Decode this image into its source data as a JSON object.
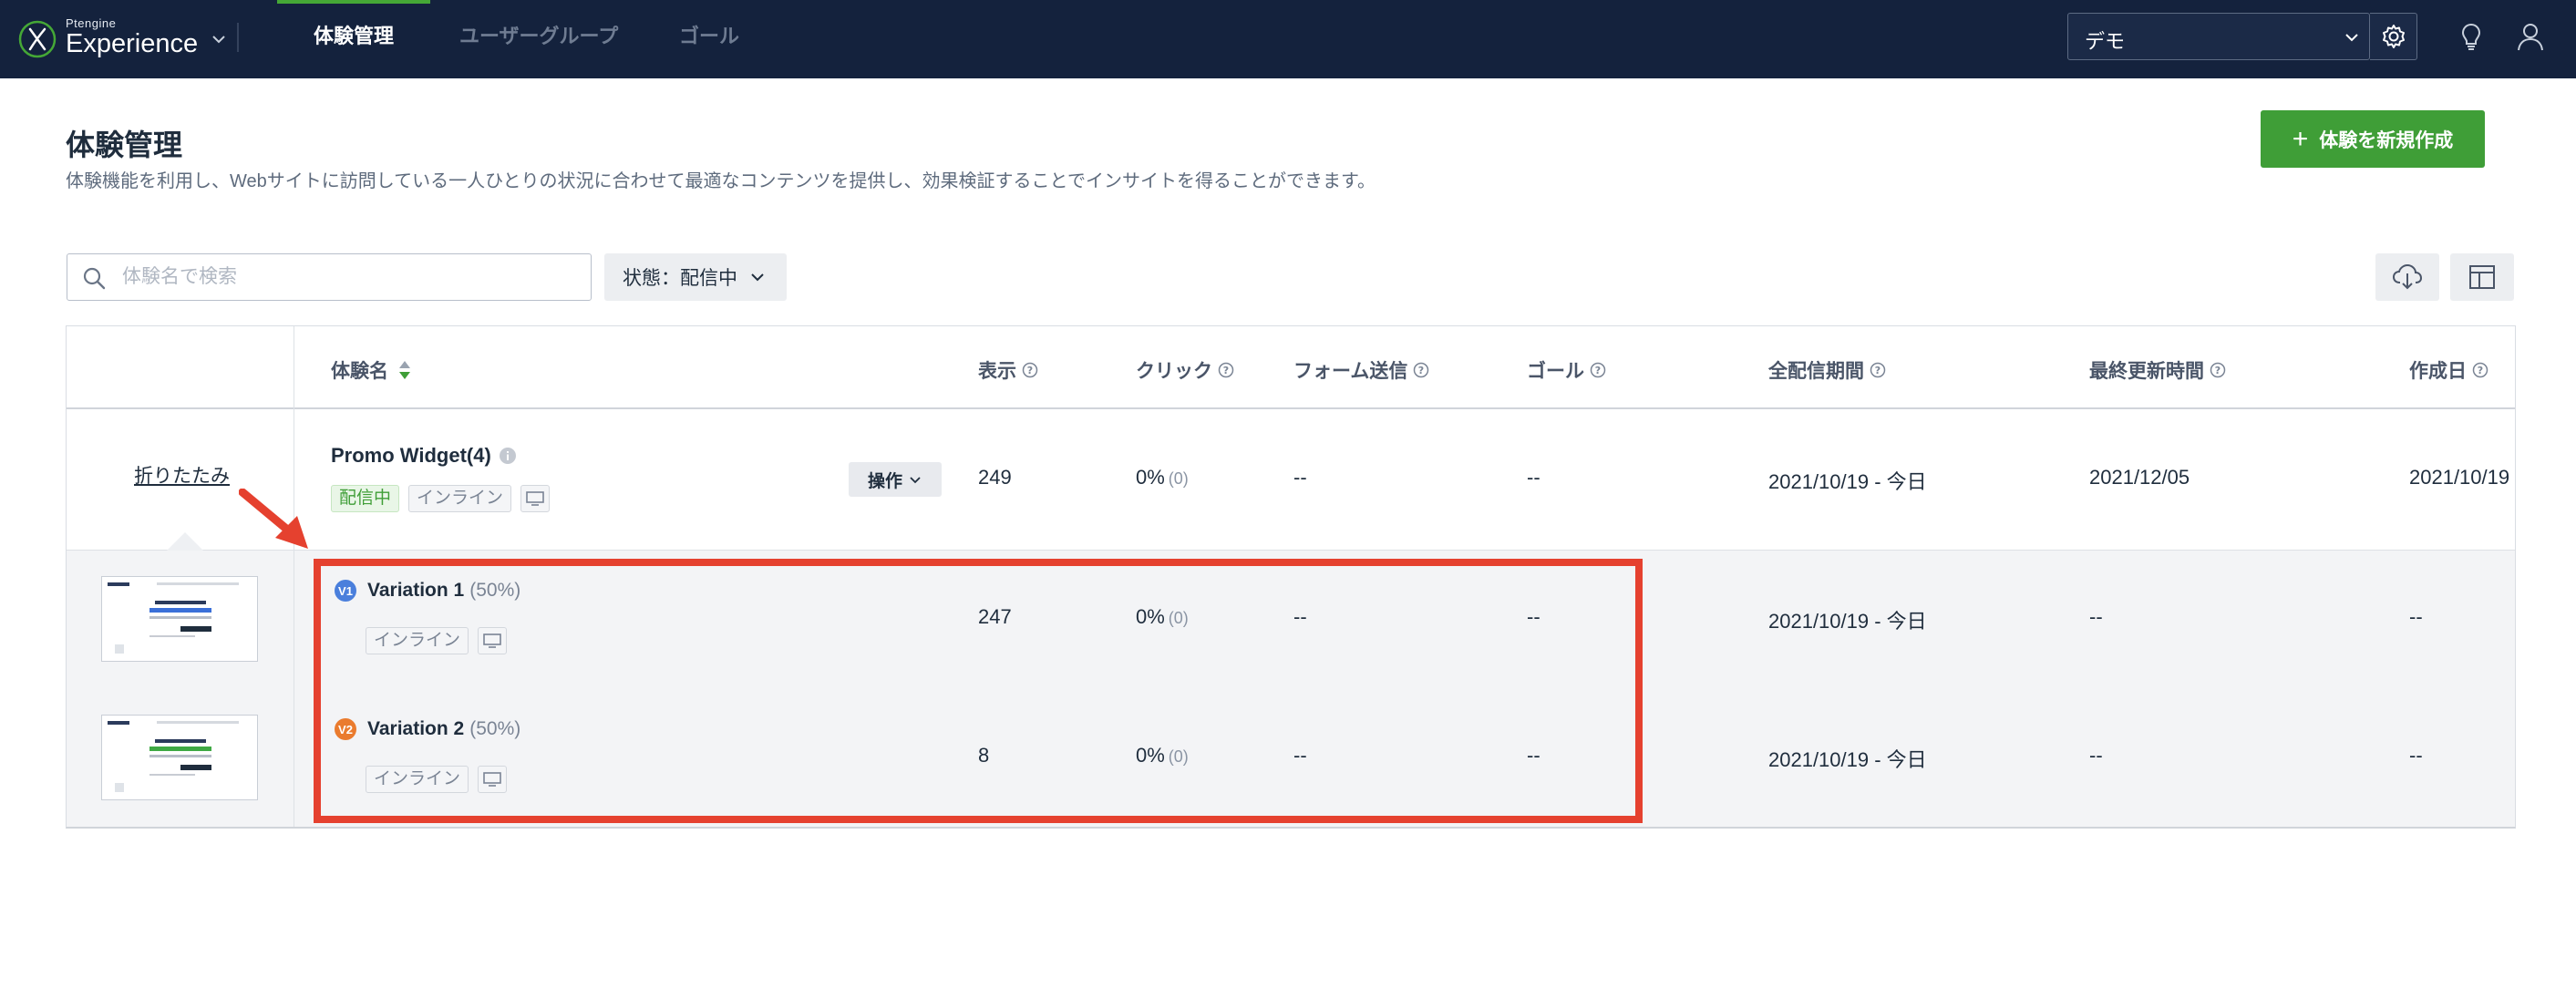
{
  "nav": {
    "logo_small": "Ptengine",
    "logo_big": "Experience",
    "tabs": [
      {
        "label": "体験管理",
        "active": true
      },
      {
        "label": "ユーザーグループ",
        "active": false
      },
      {
        "label": "ゴール",
        "active": false
      }
    ],
    "tenant": "デモ",
    "icons": [
      "chevron-down-icon",
      "gear-icon",
      "lightbulb-icon",
      "user-icon"
    ]
  },
  "header": {
    "title": "体験管理",
    "description": "体験機能を利用し、Webサイトに訪問している一人ひとりの状況に合わせて最適なコンテンツを提供し、効果検証することでインサイトを得ることができます。",
    "create_button": "体験を新規作成"
  },
  "filters": {
    "search_placeholder": "体験名で検索",
    "status_label": "状態：",
    "status_value": "配信中"
  },
  "table": {
    "columns": [
      "体験名",
      "表示",
      "クリック",
      "フォーム送信",
      "ゴール",
      "全配信期間",
      "最終更新時間",
      "作成日"
    ],
    "parent": {
      "collapse_label": "折りたたみ",
      "name": "Promo Widget(4)",
      "status_tag": "配信中",
      "type_tag": "インライン",
      "ops_label": "操作",
      "impressions": "249",
      "click_rate": "0%",
      "click_count": "(0)",
      "form_submit": "--",
      "goal": "--",
      "period": "2021/10/19 - 今日",
      "updated": "2021/12/05",
      "created": "2021/10/19"
    },
    "variations": [
      {
        "badge": "V1",
        "badge_color": "#4a7fdc",
        "name": "Variation 1",
        "pct": "(50%)",
        "type_tag": "インライン",
        "impressions": "247",
        "click_rate": "0%",
        "click_count": "(0)",
        "form_submit": "--",
        "goal": "--",
        "period": "2021/10/19 - 今日",
        "updated": "--",
        "created": "--"
      },
      {
        "badge": "V2",
        "badge_color": "#ea7b2e",
        "name": "Variation 2",
        "pct": "(50%)",
        "type_tag": "インライン",
        "impressions": "8",
        "click_rate": "0%",
        "click_count": "(0)",
        "form_submit": "--",
        "goal": "--",
        "period": "2021/10/19 - 今日",
        "updated": "--",
        "created": "--"
      }
    ]
  },
  "colors": {
    "nav_bg": "#14223d",
    "accent_green": "#3f9e37",
    "highlight_red": "#e5412f"
  }
}
